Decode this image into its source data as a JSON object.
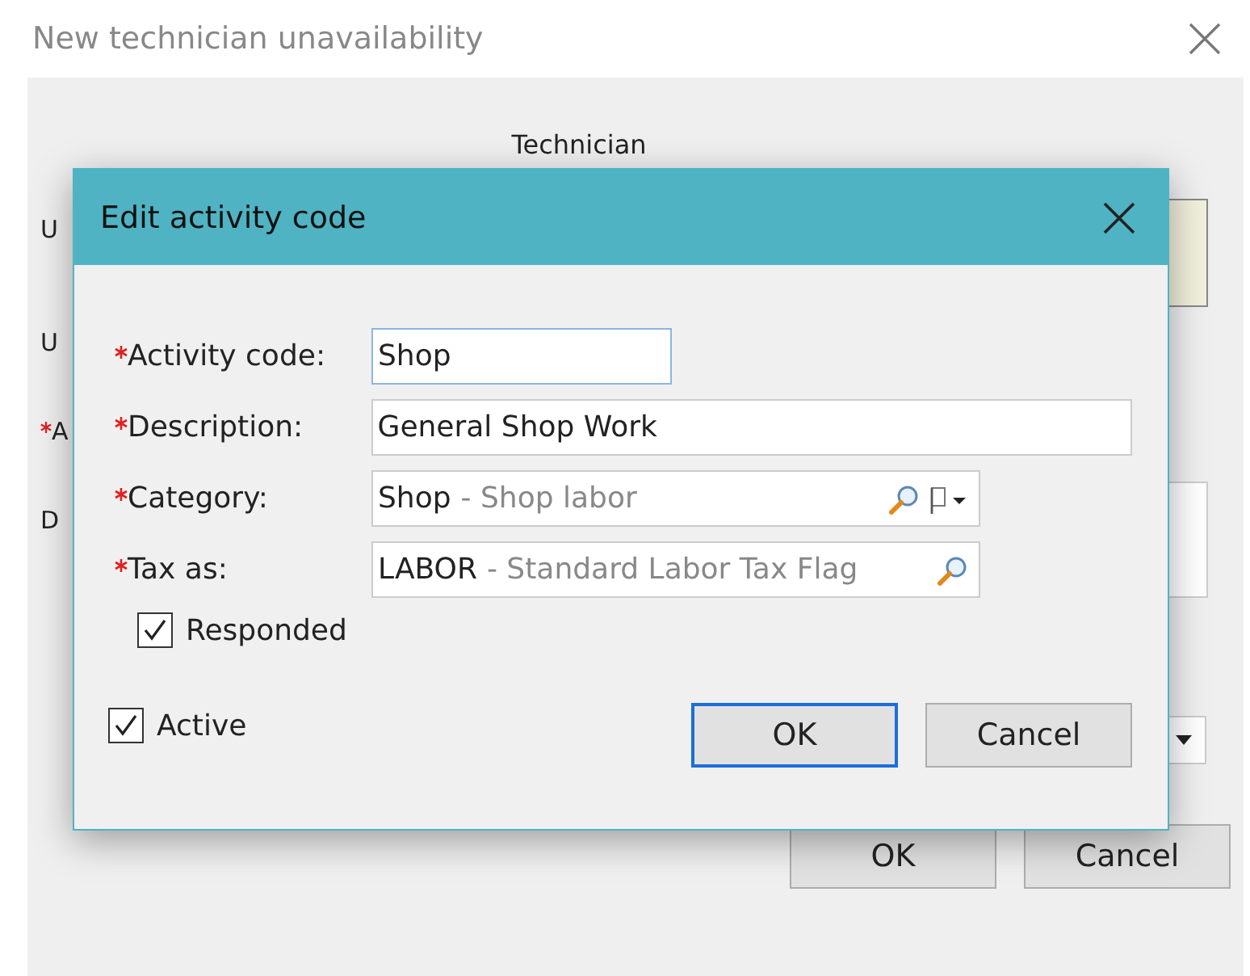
{
  "window": {
    "title": "New technician unavailability"
  },
  "background_form": {
    "heading": "Technician",
    "rows": [
      {
        "label": "U",
        "required": false,
        "kind": "tinted"
      },
      {
        "label": "U",
        "required": false,
        "kind": "plain"
      },
      {
        "label": "A",
        "required": true,
        "kind": "plain"
      },
      {
        "label": "D",
        "required": false,
        "kind": "box"
      }
    ],
    "buttons": [
      "OK",
      "Cancel"
    ]
  },
  "dialog": {
    "title": "Edit activity code",
    "fields": [
      {
        "label": "Activity code:",
        "required": true,
        "kind": "text",
        "value": "Shop",
        "focused": true
      },
      {
        "label": "Description:",
        "required": true,
        "kind": "text",
        "value": "General Shop Work",
        "focused": false
      },
      {
        "label": "Category:",
        "required": true,
        "kind": "lookup_menu",
        "code": "Shop",
        "description": "- Shop labor"
      },
      {
        "label": "Tax as:",
        "required": true,
        "kind": "lookup",
        "code": "LABOR",
        "description": "- Standard Labor Tax Flag"
      }
    ],
    "responded": {
      "label": "Responded",
      "checked": true
    },
    "active": {
      "label": "Active",
      "checked": true
    },
    "buttons": [
      {
        "label": "OK",
        "default": true
      },
      {
        "label": "Cancel",
        "default": false
      }
    ]
  }
}
